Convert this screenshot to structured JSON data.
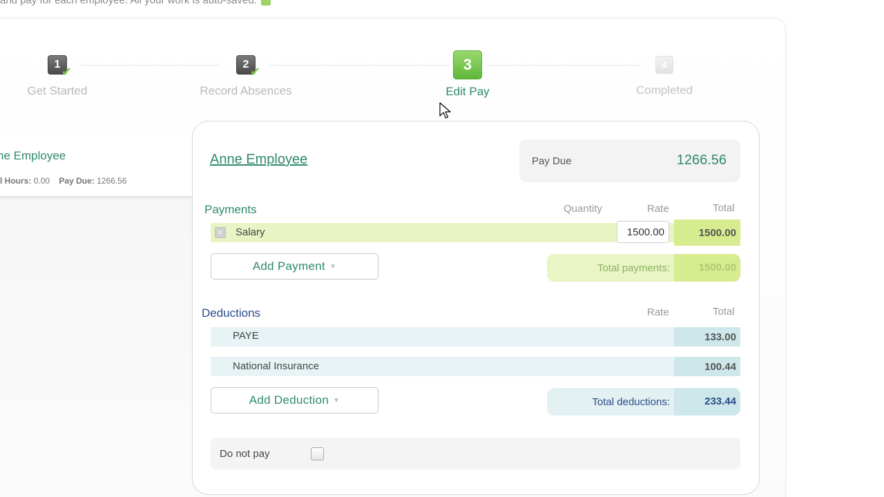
{
  "top_note": "and pay for each employee. All your work is auto-saved.",
  "steps": [
    {
      "number": "1",
      "label": "Get Started",
      "state": "done"
    },
    {
      "number": "2",
      "label": "Record Absences",
      "state": "done"
    },
    {
      "number": "3",
      "label": "Edit Pay",
      "state": "active"
    },
    {
      "number": "4",
      "label": "Completed",
      "state": "future"
    }
  ],
  "employee_list": {
    "name": "ne Employee",
    "hours_label": "l Hours:",
    "hours_value": "0.00",
    "paydue_label": "Pay Due:",
    "paydue_value": "1266.56"
  },
  "employee": {
    "name": "Anne Employee",
    "pay_due_label": "Pay Due",
    "pay_due_value": "1266.56"
  },
  "payments": {
    "title": "Payments",
    "col_quantity": "Quantity",
    "col_rate": "Rate",
    "col_total": "Total",
    "items": [
      {
        "label": "Salary",
        "rate": "1500.00",
        "total": "1500.00"
      }
    ],
    "add_button": "Add Payment",
    "total_label": "Total payments:",
    "total_value": "1500.00"
  },
  "deductions": {
    "title": "Deductions",
    "col_rate": "Rate",
    "col_total": "Total",
    "items": [
      {
        "label": "PAYE",
        "total": "133.00"
      },
      {
        "label": "National Insurance",
        "total": "100.44"
      }
    ],
    "add_button": "Add Deduction",
    "total_label": "Total deductions:",
    "total_value": "233.44"
  },
  "do_not_pay": {
    "label": "Do not pay",
    "checked": false
  },
  "colors": {
    "brand_green": "#2e8a6a",
    "active_step": "#6cc040",
    "payment_row": "#e8f4c4",
    "deduction_row": "#e8f3f5",
    "deduction_blue": "#2b4b8a"
  }
}
